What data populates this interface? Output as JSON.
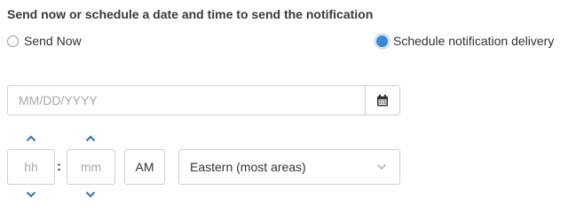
{
  "heading": "Send now or schedule a date and time to send the notification",
  "options": {
    "send_now": {
      "label": "Send Now",
      "selected": false
    },
    "schedule": {
      "label": "Schedule notification delivery",
      "selected": true
    }
  },
  "date": {
    "placeholder": "MM/DD/YYYY",
    "value": "",
    "icon": "calendar-icon"
  },
  "time": {
    "hour_placeholder": "hh",
    "minute_placeholder": "mm",
    "separator": ":",
    "meridiem": "AM",
    "up_icon": "chevron-up-icon",
    "down_icon": "chevron-down-icon"
  },
  "timezone": {
    "selected": "Eastern (most areas)",
    "icon": "chevron-down-icon"
  },
  "colors": {
    "accent": "#3c86d6",
    "chevron": "#3a78b8",
    "border": "#cfcfcf"
  }
}
